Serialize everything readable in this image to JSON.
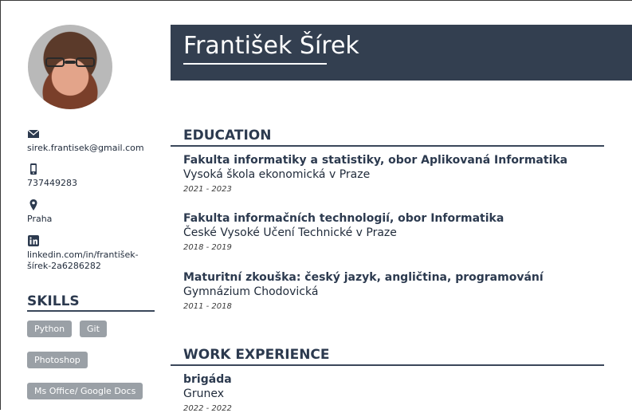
{
  "name": "František Šírek",
  "contacts": [
    {
      "icon": "mail-icon",
      "text": "sirek.frantisek@gmail.com"
    },
    {
      "icon": "phone-icon",
      "text": "737449283"
    },
    {
      "icon": "location-pin-icon",
      "text": "Praha"
    },
    {
      "icon": "linkedin-icon",
      "text": "linkedin.com/in/františek-šírek-2a6286282"
    }
  ],
  "skills": {
    "title": "SKILLS",
    "items": [
      "Python",
      "Git",
      "Photoshop",
      "Ms Office/ Google Docs"
    ]
  },
  "education": {
    "title": "EDUCATION",
    "entries": [
      {
        "title": "Fakulta informatiky a statistiky, obor Aplikovaná Informatika",
        "subtitle": "Vysoká škola ekonomická v Praze",
        "dates": "2021 - 2023"
      },
      {
        "title": "Fakulta informačních technologií, obor Informatika",
        "subtitle": "České Vysoké Učení Technické v Praze",
        "dates": "2018 - 2019"
      },
      {
        "title": "Maturitní zkouška: český jazyk, angličtina, programování",
        "subtitle": "Gymnázium Chodovická",
        "dates": "2011 - 2018"
      }
    ]
  },
  "work": {
    "title": "WORK EXPERIENCE",
    "entries": [
      {
        "title": "brigáda",
        "subtitle": "Grunex",
        "dates": "2022 - 2022"
      }
    ]
  },
  "colors": {
    "header_bg": "#333f50",
    "chip_bg": "#9aa0a6",
    "heading": "#2c3a4f"
  }
}
